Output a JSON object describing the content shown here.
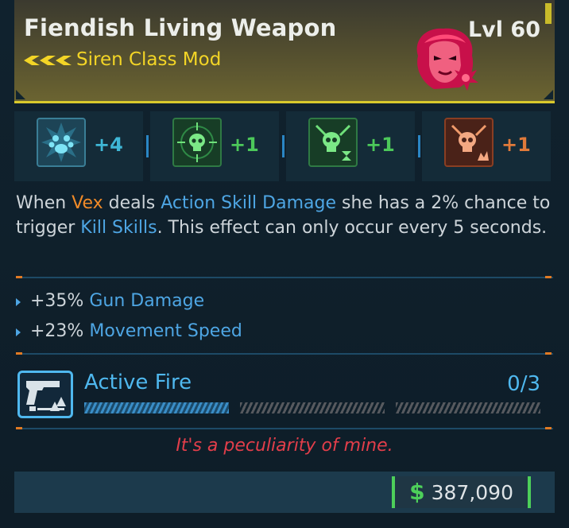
{
  "item": {
    "name": "Fiendish Living Weapon",
    "level": "Lvl 60",
    "type": "Siren Class Mod",
    "character": "Vex"
  },
  "skills": [
    {
      "value": "+4",
      "color": "#3fb7d6",
      "icon": "paw-burst-icon"
    },
    {
      "value": "+1",
      "color": "#4cc85a",
      "icon": "skull-crosshair-icon"
    },
    {
      "value": "+1",
      "color": "#4cc85a",
      "icon": "skull-hourglass-icon"
    },
    {
      "value": "+1",
      "color": "#e07a3a",
      "icon": "skull-flame-icon"
    }
  ],
  "description": {
    "p1": "When ",
    "p2": "Vex",
    "p3": " deals ",
    "p4": "Action Skill Damage",
    "p5": " she has a 2% chance to trigger ",
    "p6": "Kill Skills",
    "p7": ". This effect can only occur every 5 seconds."
  },
  "stats": [
    {
      "value": "+35%",
      "name": "Gun Damage"
    },
    {
      "value": "+23%",
      "name": "Movement Speed"
    }
  ],
  "active": {
    "name": "Active Fire",
    "count": "0/3",
    "icon": "pistol-icon",
    "progress": 0.33
  },
  "quote": "It's a peculiarity of mine.",
  "price": {
    "symbol": "$",
    "amount": "387,090"
  },
  "colors": {
    "legendary": "#f3d526",
    "accent_blue": "#4ea6e4",
    "money_green": "#4dcf5a",
    "quote_red": "#e23e4a"
  }
}
